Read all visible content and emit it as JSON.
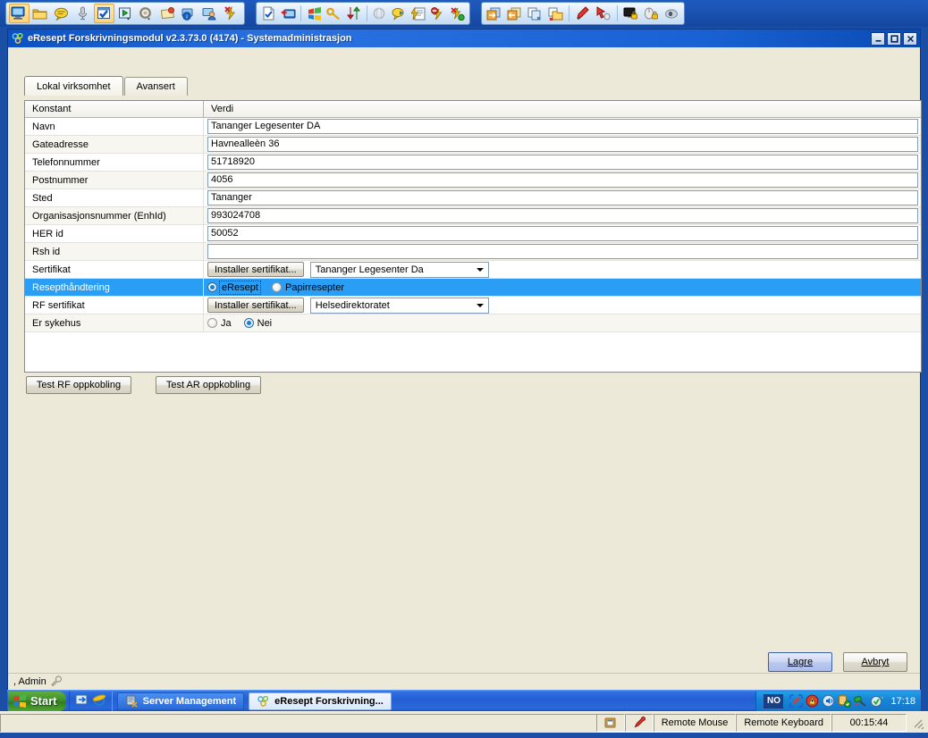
{
  "remote_toolbar": {
    "groups": [
      {
        "name": "session-group",
        "icons": [
          "remote-desktop-icon",
          "folder-icon",
          "chat-balloon-icon",
          "microphone-icon",
          "checklist-selected-icon",
          "run-green-play-icon",
          "gear-options-icon",
          "notes-icon",
          "info-user-icon",
          "user-account-icon",
          "lightning-disconnect-icon"
        ]
      },
      {
        "name": "management-group",
        "icons": [
          "task-check-icon",
          "remote-screen-transfer-icon",
          "windows-flag-icon",
          "key-security-icon",
          "updown-arrows-icon",
          "globe-disabled-icon",
          "chat-transfer-icon",
          "script-lightning-icon",
          "block-lightning-icon",
          "lightning-ok-icon"
        ]
      },
      {
        "name": "transfer-group",
        "icons": [
          "file-send-icon",
          "file-receive-icon",
          "file-copy-icon",
          "folder-remove-icon",
          "pen-marker-icon",
          "pointer-arrow-icon",
          "lock-screen-icon",
          "lock-mouse-icon",
          "eye-hidden-icon"
        ]
      }
    ]
  },
  "window": {
    "title": "eResept Forskrivningsmodul v2.3.73.0 (4174) - Systemadministrasjon",
    "icon": "eresept-molecule-icon",
    "controls": {
      "minimize": "_",
      "maximize": "❐",
      "close": "✕"
    }
  },
  "tabs": [
    {
      "label": "Lokal virksomhet",
      "active": true
    },
    {
      "label": "Avansert",
      "active": false
    }
  ],
  "grid": {
    "headers": {
      "key": "Konstant",
      "value": "Verdi"
    },
    "rows": [
      {
        "key": "Navn",
        "type": "text",
        "value": "Tananger Legesenter DA"
      },
      {
        "key": "Gateadresse",
        "type": "text",
        "value": "Havnealleèn 36"
      },
      {
        "key": "Telefonnummer",
        "type": "text",
        "value": "51718920"
      },
      {
        "key": "Postnummer",
        "type": "text",
        "value": "4056"
      },
      {
        "key": "Sted",
        "type": "text",
        "value": "Tananger"
      },
      {
        "key": "Organisasjonsnummer (EnhId)",
        "type": "text",
        "value": "993024708"
      },
      {
        "key": "HER id",
        "type": "text",
        "value": "50052"
      },
      {
        "key": "Rsh id",
        "type": "text",
        "value": ""
      },
      {
        "key": "Sertifikat",
        "type": "button-combo",
        "button": "Installer sertifikat...",
        "combo": "Tananger Legesenter Da"
      },
      {
        "key": "Resepthåndtering",
        "type": "radio",
        "selected": true,
        "options": [
          {
            "label": "eResept",
            "checked": true,
            "focused": true
          },
          {
            "label": "Papirresepter",
            "checked": false,
            "focused": false
          }
        ]
      },
      {
        "key": "RF sertifikat",
        "type": "button-combo",
        "button": "Installer sertifikat...",
        "combo": "Helsedirektoratet"
      },
      {
        "key": "Er sykehus",
        "type": "radio",
        "selected": false,
        "options": [
          {
            "label": "Ja",
            "checked": false,
            "focused": false
          },
          {
            "label": "Nei",
            "checked": true,
            "focused": false
          }
        ]
      }
    ]
  },
  "test_buttons": [
    {
      "label": "Test RF oppkobling"
    },
    {
      "label": "Test AR oppkobling"
    }
  ],
  "footer_buttons": [
    {
      "label": "Lagre",
      "accel": "L",
      "default": true
    },
    {
      "label": "Avbryt",
      "accel": "A",
      "default": false
    }
  ],
  "app_status": {
    "user": ", Admin",
    "icon": "wrench-icon"
  },
  "taskbar": {
    "start_label": "Start",
    "quick_launch": [
      "show-desktop-icon",
      "internet-explorer-icon"
    ],
    "buttons": [
      {
        "label": "Server Management",
        "icon": "server-management-icon",
        "active": false
      },
      {
        "label": "eResept Forskrivning...",
        "icon": "eresept-molecule-icon",
        "active": true
      }
    ],
    "tray": {
      "keyboard_layout": "NO",
      "icons": [
        "network-connection-icon",
        "antivirus-shield-icon",
        "sound-volume-icon",
        "database-sync-icon",
        "network-cable-icon",
        "update-ready-icon"
      ],
      "clock": "17:18"
    }
  },
  "remote_status": {
    "left_icons": [
      "restore-window-icon",
      "pin-icon"
    ],
    "segments": [
      "Remote Mouse",
      "Remote Keyboard",
      "00:15:44"
    ]
  },
  "colors": {
    "title_bar": "#1a62d4",
    "selection": "#2a9ef4",
    "taskbar": "#2e6fe0",
    "window_face": "#ece9d8",
    "default_button": "#b9c8ee"
  }
}
